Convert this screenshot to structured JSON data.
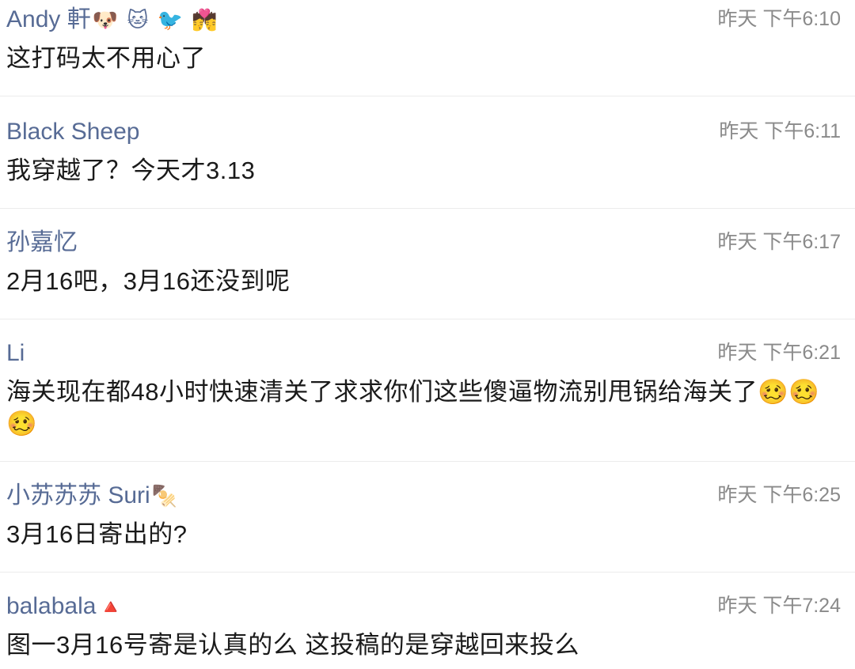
{
  "comments": [
    {
      "author": "Andy 軒",
      "author_emoji": "🐶 🐱 🐦 💏",
      "time": "昨天 下午6:10",
      "text": "这打码太不用心了"
    },
    {
      "author": "Black Sheep",
      "author_emoji": "",
      "time": "昨天 下午6:11",
      "text": "我穿越了？今天才3.13"
    },
    {
      "author": "孙嘉忆",
      "author_emoji": "",
      "time": "昨天 下午6:17",
      "text": "2月16吧，3月16还没到呢"
    },
    {
      "author": "Li",
      "author_emoji": "",
      "time": "昨天 下午6:21",
      "text": "海关现在都48小时快速清关了求求你们这些傻逼物流别甩锅给海关了🥴🥴🥴"
    },
    {
      "author": "小苏苏苏 Suri",
      "author_emoji": "🍢",
      "time": "昨天 下午6:25",
      "text": "3月16日寄出的?"
    },
    {
      "author": "balabala",
      "author_emoji": "🔺",
      "time": "昨天 下午7:24",
      "text": "图一3月16号寄是认真的么  这投稿的是穿越回来投么"
    }
  ]
}
